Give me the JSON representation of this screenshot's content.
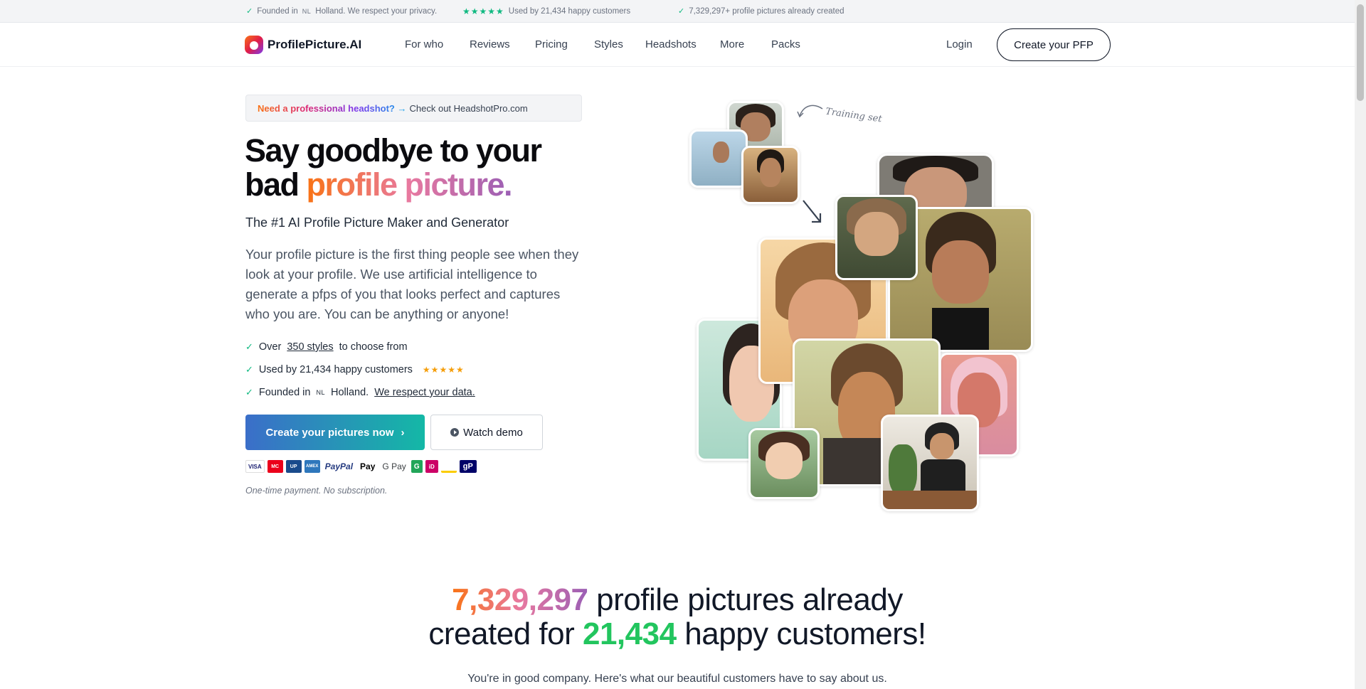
{
  "topbar": {
    "founded": "Founded in",
    "founded_nl": "NL",
    "founded_rest": "Holland. We respect your privacy.",
    "stars": "★★★★★",
    "used_by": "Used by 21,434 happy customers",
    "created": "7,329,297+ profile pictures already created"
  },
  "nav": {
    "logo": "ProfilePicture.AI",
    "links": [
      "For who",
      "Reviews",
      "Pricing",
      "Styles",
      "Headshots",
      "More",
      "Packs"
    ],
    "login": "Login",
    "cta": "Create your PFP"
  },
  "hero": {
    "promo_highlight": "Need a professional headshot? →",
    "promo_rest": "Check out HeadshotPro.com",
    "title_line1": "Say goodbye to your",
    "title_line2_plain": "bad ",
    "title_line2_grad": "profile picture.",
    "subtitle": "The #1 AI Profile Picture Maker and Generator",
    "description": "Your profile picture is the first thing people see when they look at your profile. We use artificial intelligence to generate a pfps of you that looks perfect and captures who you are. You can be anything or anyone!",
    "bullet1_pre": "Over",
    "bullet1_link": "350 styles",
    "bullet1_post": "to choose from",
    "bullet2": "Used by 21,434 happy customers",
    "bullet2_stars": "★★★★★",
    "bullet3_pre": "Founded in",
    "bullet3_nl": "NL",
    "bullet3_mid": "Holland.",
    "bullet3_link": "We respect your data.",
    "primary_cta": "Create your pictures now",
    "primary_chevron": "›",
    "secondary_cta": "Watch demo",
    "note": "One-time payment. No subscription.",
    "training_label": "Training set",
    "payments": [
      "VISA",
      "MC",
      "UP",
      "AMEX",
      "PayPal",
      "Pay",
      "G Pay",
      "G",
      "iD",
      "bancontact",
      "gP"
    ]
  },
  "stats": {
    "pictures_count": "7,329,297",
    "line1_rest": "profile pictures already",
    "line2_pre": "created for",
    "customers_count": "21,434",
    "line2_post": "happy customers!",
    "tagline": "You're in good company. Here's what our beautiful customers have to say about us."
  }
}
